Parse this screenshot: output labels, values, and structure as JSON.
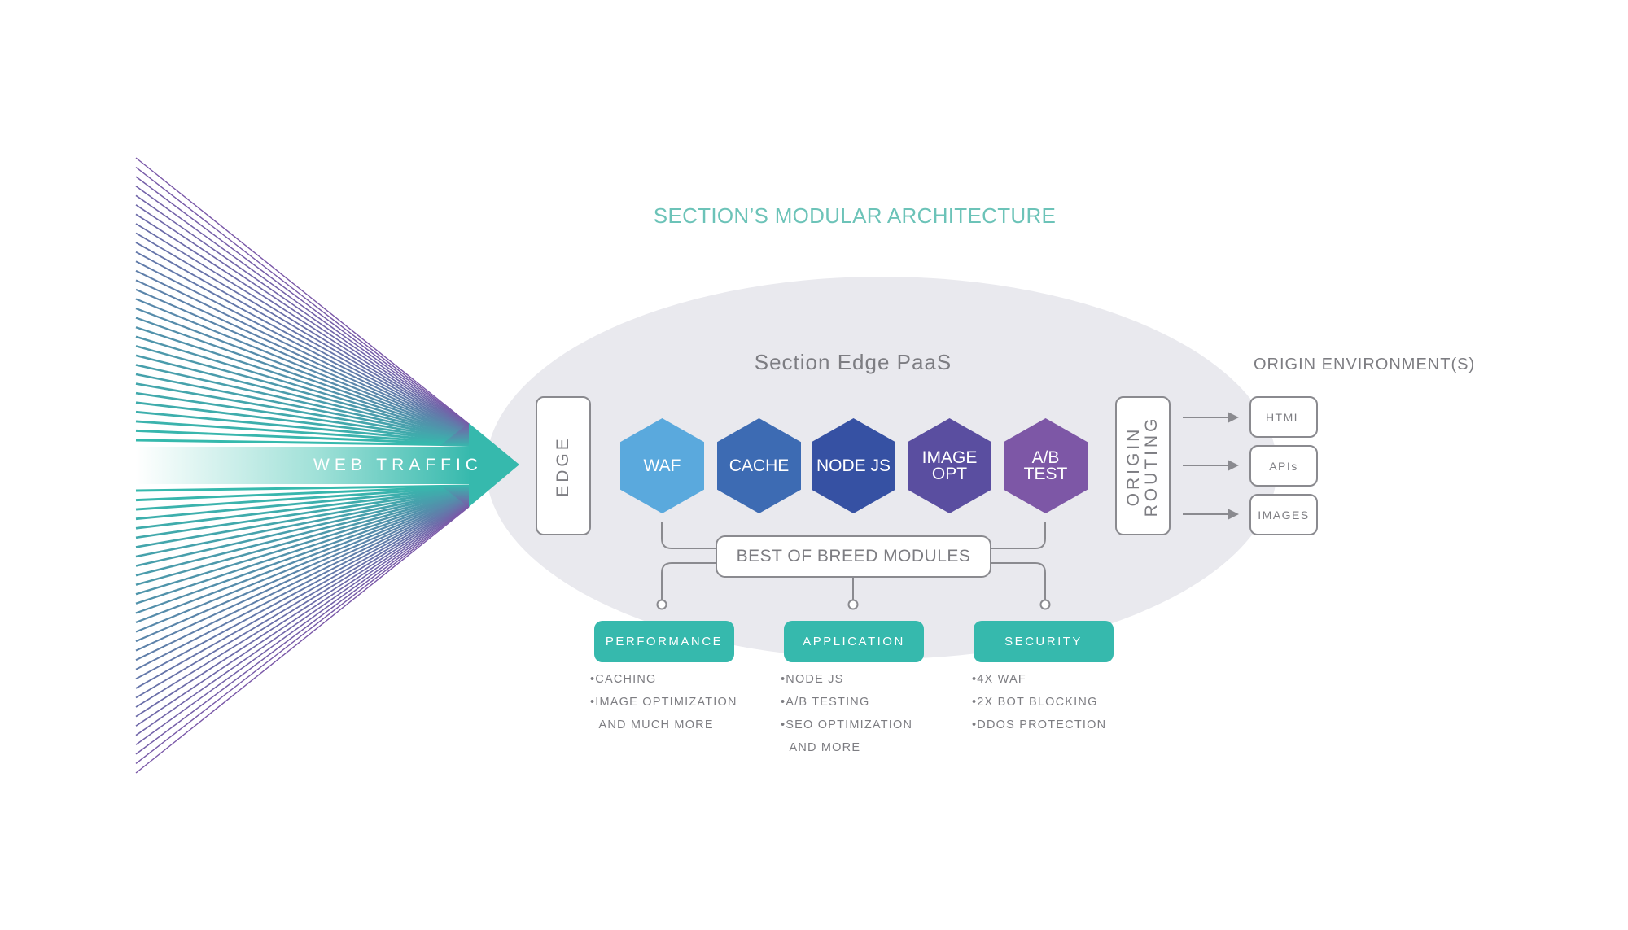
{
  "title": "SECTION’S MODULAR ARCHITECTURE",
  "traffic": {
    "label": "WEB TRAFFIC",
    "colors": {
      "teal": "#36b9ad",
      "purple": "#7a58a8"
    }
  },
  "platform": {
    "title": "Section Edge PaaS",
    "edge_label": "EDGE",
    "origin_routing_label": [
      "ORIGIN",
      "ROUTING"
    ],
    "ellipse_color": "#e9e9ee"
  },
  "modules": [
    {
      "label": [
        "WAF"
      ],
      "color": "#5aa9dd"
    },
    {
      "label": [
        "CACHE"
      ],
      "color": "#3d6bb3"
    },
    {
      "label": [
        "NODE JS"
      ],
      "color": "#3651a3"
    },
    {
      "label": [
        "IMAGE",
        "OPT"
      ],
      "color": "#5a4ea0"
    },
    {
      "label": [
        "A/B",
        "TEST"
      ],
      "color": "#7d57a6"
    }
  ],
  "best_of_breed": "BEST OF BREED MODULES",
  "origin": {
    "title": "ORIGIN ENVIRONMENT(S)",
    "targets": [
      "HTML",
      "APIs",
      "IMAGES"
    ]
  },
  "categories": [
    {
      "label": "PERFORMANCE",
      "bullets": [
        "•CACHING",
        "•IMAGE OPTIMIZATION",
        "  AND MUCH MORE"
      ]
    },
    {
      "label": "APPLICATION",
      "bullets": [
        "•NODE JS",
        "•A/B TESTING",
        "•SEO OPTIMIZATION",
        "  AND MORE"
      ]
    },
    {
      "label": "SECURITY",
      "bullets": [
        "•4X WAF",
        "•2X BOT BLOCKING",
        "•DDOS PROTECTION"
      ]
    }
  ],
  "accent_color": "#36b9ad",
  "line_color": "#8a8a8f"
}
